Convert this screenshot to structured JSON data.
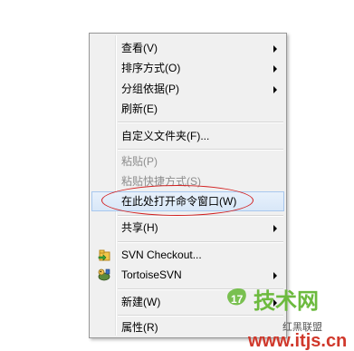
{
  "menu": {
    "items": [
      {
        "label": "查看(V)",
        "submenu": true,
        "disabled": false
      },
      {
        "label": "排序方式(O)",
        "submenu": true,
        "disabled": false
      },
      {
        "label": "分组依据(P)",
        "submenu": true,
        "disabled": false
      },
      {
        "label": "刷新(E)",
        "submenu": false,
        "disabled": false
      },
      {
        "label": "自定义文件夹(F)...",
        "submenu": false,
        "disabled": false
      },
      {
        "label": "粘贴(P)",
        "submenu": false,
        "disabled": true
      },
      {
        "label": "粘贴快捷方式(S)",
        "submenu": false,
        "disabled": true
      },
      {
        "label": "在此处打开命令窗口(W)",
        "submenu": false,
        "disabled": false,
        "highlighted": true
      },
      {
        "label": "共享(H)",
        "submenu": true,
        "disabled": false
      },
      {
        "label": "SVN Checkout...",
        "submenu": false,
        "disabled": false,
        "icon": "svn-checkout-icon"
      },
      {
        "label": "TortoiseSVN",
        "submenu": true,
        "disabled": false,
        "icon": "tortoisesvn-icon"
      },
      {
        "label": "新建(W)",
        "submenu": true,
        "disabled": false
      },
      {
        "label": "属性(R)",
        "submenu": false,
        "disabled": false
      }
    ]
  },
  "annotation": {
    "color": "#d21f1f"
  },
  "watermark": {
    "brand": "技术网",
    "site": "www.itjs.cn",
    "tag": "红黑联盟",
    "colors": {
      "green": "#5aa83a",
      "red": "#d0382b"
    }
  }
}
